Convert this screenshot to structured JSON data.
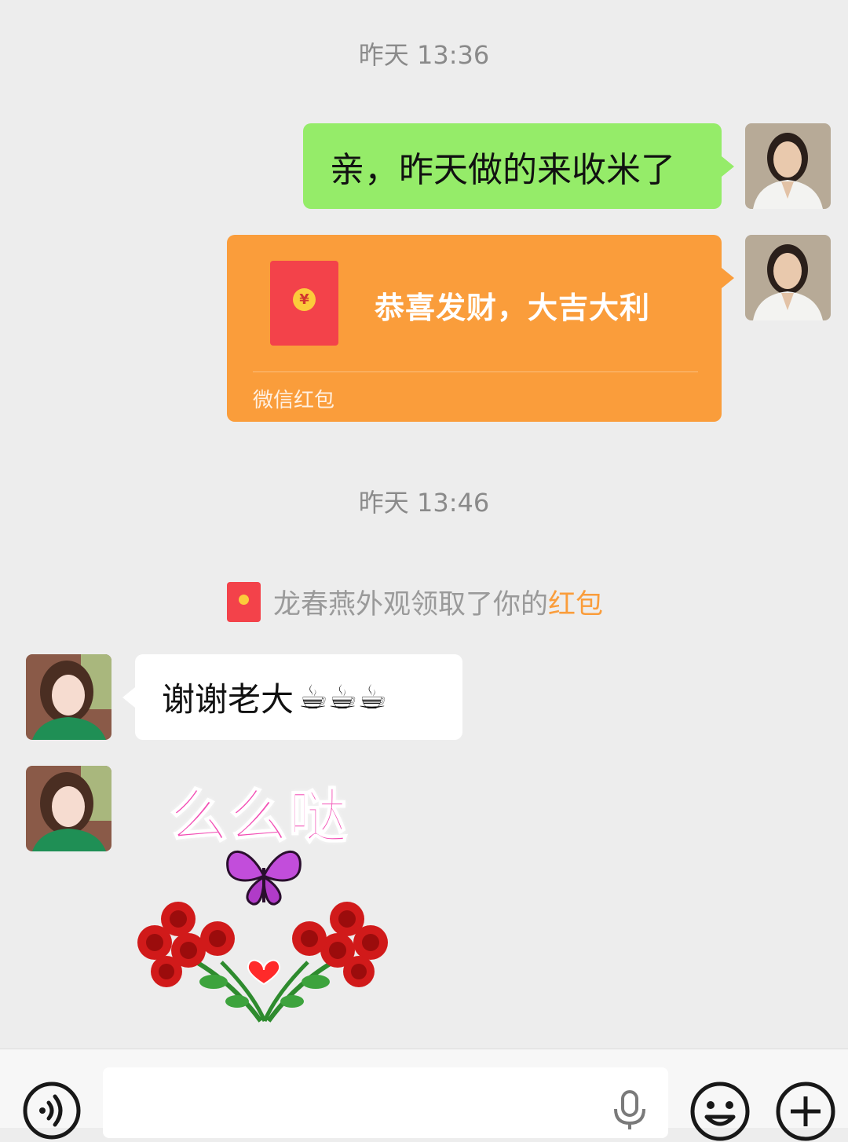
{
  "chat": {
    "timestamp_1": "昨天 13:36",
    "self_message_1": "亲，昨天做的来收米了",
    "red_packet": {
      "coin_symbol": "¥",
      "title": "恭喜发财，大吉大利",
      "footer": "微信红包"
    },
    "timestamp_2": "昨天 13:46",
    "notice": {
      "prefix": "龙春燕外观领取了你的",
      "highlight": "红包"
    },
    "other_message_1": {
      "text": "谢谢老大",
      "emoji": [
        "☕",
        "☕",
        "☕"
      ]
    },
    "sticker": {
      "text": "么么哒"
    }
  },
  "input_bar": {
    "value": "",
    "icons": [
      "voice-icon",
      "microphone-icon",
      "emoji-icon",
      "plus-icon"
    ]
  },
  "colors": {
    "background": "#ededed",
    "self_bubble": "#95ec69",
    "red_packet": "#fa9d3b",
    "envelope": "#f3424a",
    "highlight": "#fa9d3b"
  }
}
